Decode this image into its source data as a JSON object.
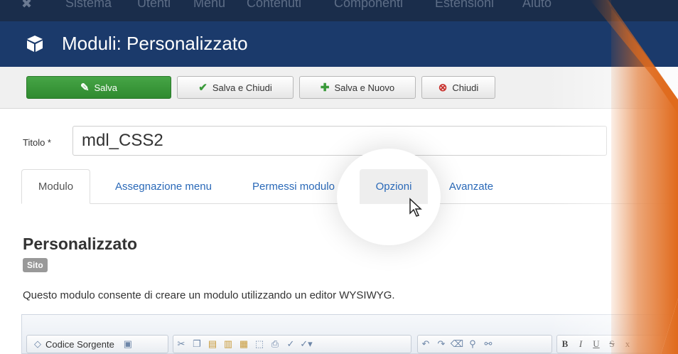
{
  "menubar": {
    "items": [
      "Sistema",
      "Utenti",
      "Menu",
      "Contenuti",
      "Componenti",
      "Estensioni",
      "Aiuto"
    ]
  },
  "header": {
    "title": "Moduli: Personalizzato",
    "icon": "cube-icon"
  },
  "toolbar": {
    "save_label": "Salva",
    "save_close_label": "Salva e Chiudi",
    "save_new_label": "Salva e Nuovo",
    "close_label": "Chiudi"
  },
  "form": {
    "title_label": "Titolo *",
    "title_value": "mdl_CSS2"
  },
  "tabs": [
    {
      "label": "Modulo",
      "active": true
    },
    {
      "label": "Assegnazione menu"
    },
    {
      "label": "Permessi modulo"
    },
    {
      "label": "Opzioni",
      "hovered": true
    },
    {
      "label": "Avanzate"
    }
  ],
  "section": {
    "title": "Personalizzato",
    "badge": "Sito",
    "description": "Questo modulo consente di creare un modulo utilizzando un editor WYSIWYG."
  },
  "editor": {
    "source_label": "Codice Sorgente"
  },
  "colors": {
    "menubar": "#1a2d4b",
    "header": "#1b3a6b",
    "success": "#3a9a3a",
    "link": "#2a69b8",
    "overlay": "#e06a1c"
  }
}
